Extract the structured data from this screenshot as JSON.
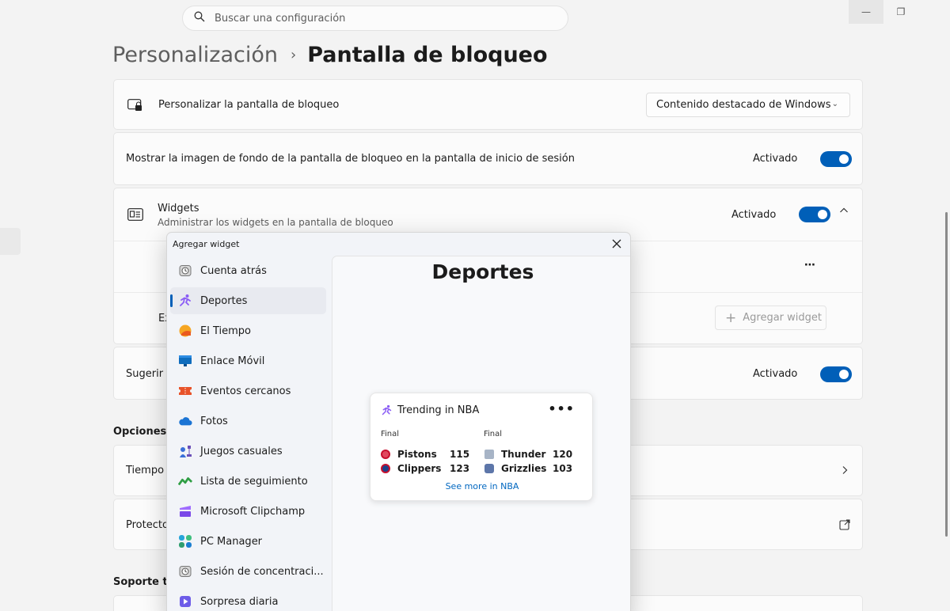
{
  "search": {
    "placeholder": "Buscar una configuración"
  },
  "breadcrumb": {
    "parent": "Personalización",
    "separator": "›",
    "current": "Pantalla de bloqueo"
  },
  "lock_screen": {
    "label": "Personalizar la pantalla de bloqueo",
    "dropdown_value": "Contenido destacado de Windows"
  },
  "background_row": {
    "label": "Mostrar la imagen de fondo de la pantalla de bloqueo en la pantalla de inicio de sesión",
    "state": "Activado"
  },
  "widgets_row": {
    "title": "Widgets",
    "subtitle": "Administrar los widgets en la pantalla de bloqueo",
    "state": "Activado"
  },
  "widget_config": {
    "row3_partial": "Ex",
    "add_widget": "Agregar widget",
    "more": "⋯"
  },
  "suggest_row": {
    "label_partial": "Sugerir w",
    "state": "Activado"
  },
  "sections": {
    "options_partial": "Opciones c",
    "support_partial": "Soporte té"
  },
  "options_rows": {
    "row1_partial": "Tiempo",
    "row2_partial": "Protecto"
  },
  "dialog": {
    "title": "Agregar widget",
    "pane_title": "Deportes",
    "items": [
      {
        "label": "Cuenta atrás",
        "icon": "timer-icon"
      },
      {
        "label": "Deportes",
        "icon": "sports-runner-icon"
      },
      {
        "label": "El Tiempo",
        "icon": "weather-sun-icon"
      },
      {
        "label": "Enlace Móvil",
        "icon": "phone-link-icon"
      },
      {
        "label": "Eventos cercanos",
        "icon": "ticket-icon"
      },
      {
        "label": "Fotos",
        "icon": "cloud-icon"
      },
      {
        "label": "Juegos casuales",
        "icon": "chess-icon"
      },
      {
        "label": "Lista de seguimiento",
        "icon": "stocks-icon"
      },
      {
        "label": "Microsoft Clipchamp",
        "icon": "clipchamp-icon"
      },
      {
        "label": "PC Manager",
        "icon": "pc-manager-icon"
      },
      {
        "label": "Sesión de concentraci...",
        "icon": "focus-timer-icon"
      },
      {
        "label": "Sorpresa diaria",
        "icon": "daily-surprise-icon"
      }
    ]
  },
  "nba_widget": {
    "title": "Trending in NBA",
    "menu": "•••",
    "game1": {
      "status": "Final",
      "team1": "Pistons",
      "score1": "115",
      "team2": "Clippers",
      "score2": "123"
    },
    "game2": {
      "status": "Final",
      "team1": "Thunder",
      "score1": "120",
      "team2": "Grizzlies",
      "score2": "103"
    },
    "link": "See more in NBA"
  },
  "colors": {
    "accent": "#005fb8",
    "link": "#0067c0",
    "card": "#fbfbfb",
    "background": "#f3f3f3"
  }
}
